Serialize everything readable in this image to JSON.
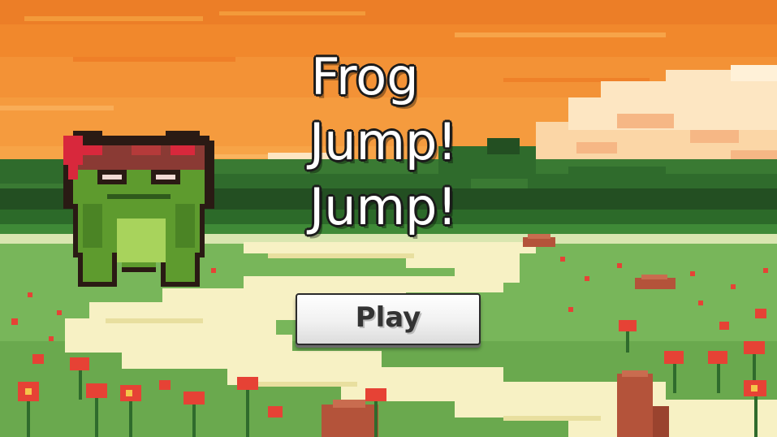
{
  "game": {
    "title_lines": [
      "Frog",
      "Jump!",
      "Jump!"
    ],
    "play_label": "Play"
  },
  "palette": {
    "sky_top": "#f08a2e",
    "sky_mid": "#f7a24a",
    "cloud": "#fde6c2",
    "cloud_shade": "#f6b785",
    "hills": "#2f6b2c",
    "hills_dark": "#234f22",
    "field": "#78b65a",
    "path": "#f7f1c4",
    "flower": "#e64235",
    "flower_center": "#f5c54a",
    "stump": "#b4533a",
    "frog_green": "#5e9b2e",
    "frog_belly": "#a8d35c",
    "headband": "#d8283c",
    "outline": "#2a1a14"
  },
  "icons": {
    "character": "frog-character-sprite"
  }
}
